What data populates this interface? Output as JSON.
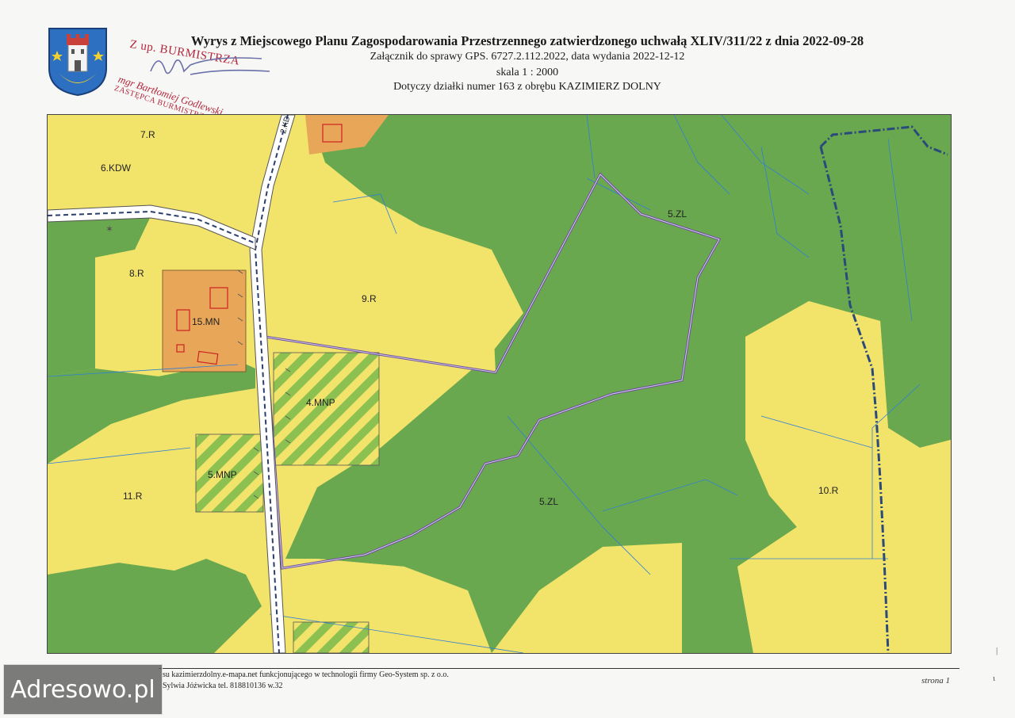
{
  "header": {
    "title": "Wyrys z Miejscowego Planu Zagospodarowania Przestrzennego zatwierdzonego uchwałą XLIV/311/22 z dnia 2022-09-28",
    "case_line": "Załącznik do sprawy GPS. 6727.2.112.2022, data wydania 2022-12-12",
    "scale_line": "skala 1 : 2000",
    "parcel_line": "Dotyczy działki numer 163 z obrębu KAZIMIERZ DOLNY"
  },
  "stamp": {
    "line1": "Z up. BURMISTRZA",
    "line2": "mgr Bartłomiej Godlewski",
    "line3": "ZASTĘPCA BURMISTRZA"
  },
  "map": {
    "colors": {
      "agricultural": "#f2e36b",
      "forest": "#6aa84f",
      "residential": "#e8a659",
      "parcel_outline": "#6b4e9b",
      "road": "#ffffff",
      "boundary": "#2a4a7a"
    },
    "zones": {
      "z7r": "7.R",
      "z6kdw": "6.KDW",
      "z8r": "8.R",
      "z15mn": "15.MN",
      "z9r": "9.R",
      "z4mnp": "4.MNP",
      "z5mnp": "5.MNP",
      "z11r": "11.R",
      "z5zl_top": "5.ZL",
      "z5zl_mid": "5.ZL",
      "z10r": "10.R",
      "road_kd": "2.KD"
    }
  },
  "footer": {
    "line1": "su kazimierzdolny.e-mapa.net funkcjonującego w technologii firmy Geo-System sp. z o.o.",
    "line2": "Sylwia Jóźwicka tel. 818810136 w.32",
    "page": "strona 1"
  },
  "watermark": {
    "label": "Adresowo.pl"
  }
}
